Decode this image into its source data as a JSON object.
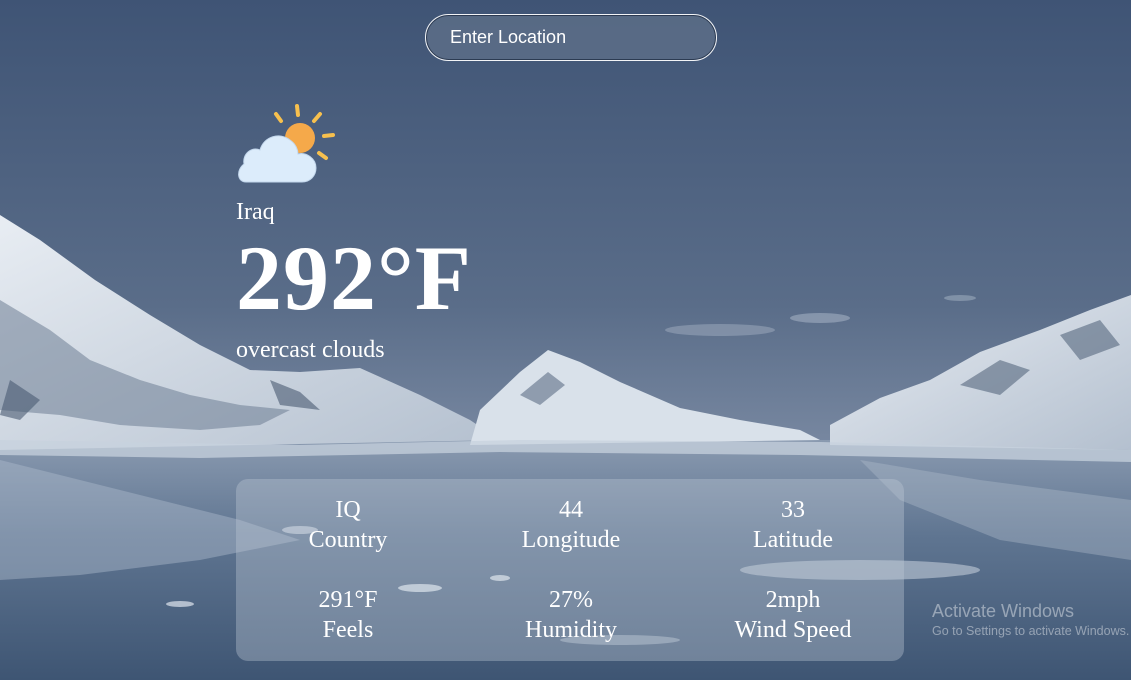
{
  "search": {
    "placeholder": "Enter Location"
  },
  "weather": {
    "icon": "partly-cloudy-icon",
    "location": "Iraq",
    "temperature": "292°F",
    "description": "overcast clouds"
  },
  "details": [
    {
      "value": "IQ",
      "label": "Country"
    },
    {
      "value": "44",
      "label": "Longitude"
    },
    {
      "value": "33",
      "label": "Latitude"
    },
    {
      "value": "291°F",
      "label": "Feels"
    },
    {
      "value": "27%",
      "label": "Humidity"
    },
    {
      "value": "2mph",
      "label": "Wind Speed"
    }
  ],
  "watermark": {
    "title": "Activate Windows",
    "subtitle": "Go to Settings to activate Windows."
  },
  "colors": {
    "sun": "#f5a94a",
    "cloud": "#dcecfb",
    "sky": "#4e607c"
  }
}
